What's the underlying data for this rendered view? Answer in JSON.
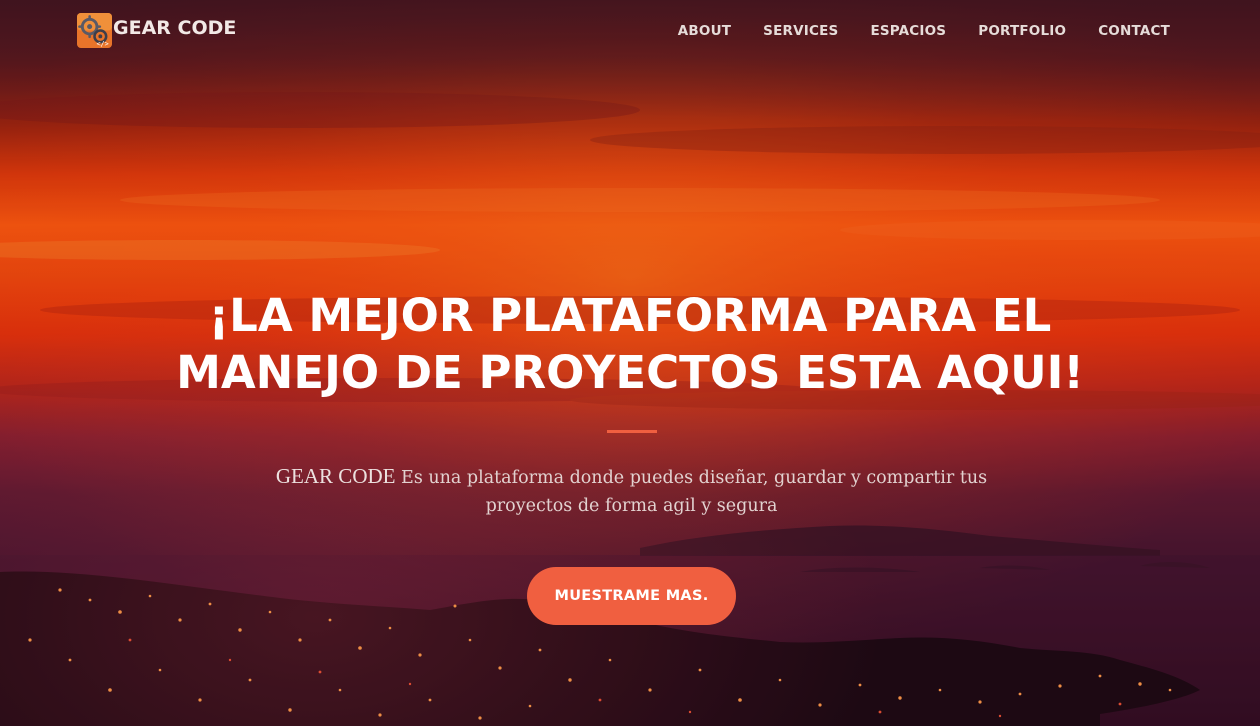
{
  "brand": {
    "name": "GEAR CODE",
    "logo_icon": "gear-code-logo"
  },
  "nav": {
    "items": [
      {
        "label": "ABOUT"
      },
      {
        "label": "SERVICES"
      },
      {
        "label": "ESPACIOS"
      },
      {
        "label": "PORTFOLIO"
      },
      {
        "label": "CONTACT"
      }
    ]
  },
  "hero": {
    "headline_line1": "¡LA MEJOR PLATAFORMA PARA EL",
    "headline_line2": "MANEJO DE PROYECTOS ESTA AQUI!",
    "tagline_brand": "GEAR CODE",
    "tagline_rest": " Es una plataforma donde puedes diseñar, guardar y compartir tus proyectos de forma agil y segura",
    "cta_label": "MUESTRAME MAS.",
    "background_description": "sunset-over-coastal-city"
  },
  "colors": {
    "accent": "#f05f40",
    "nav_text": "#e6dcd9",
    "headline": "#ffffff"
  }
}
